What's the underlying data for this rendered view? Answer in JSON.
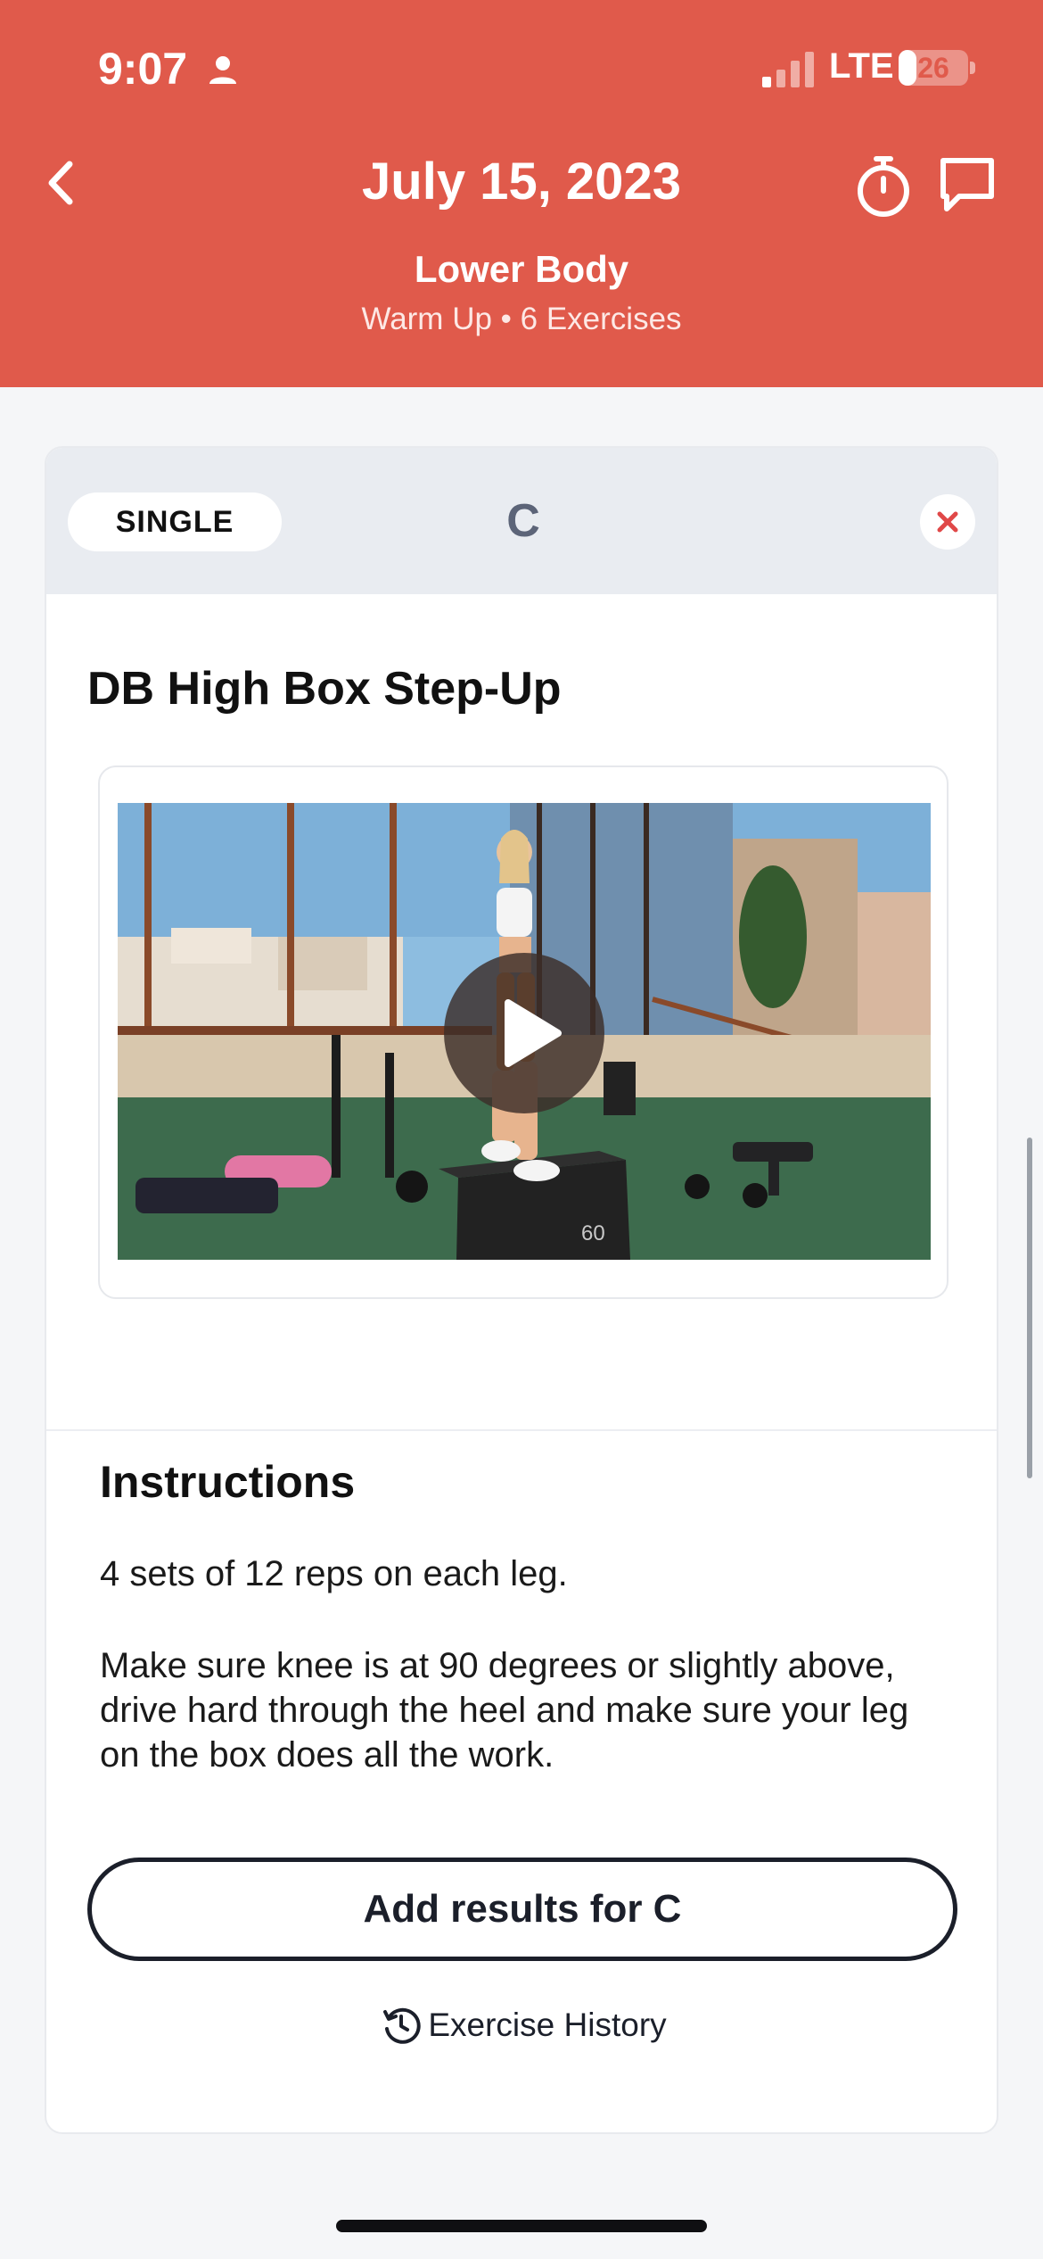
{
  "status_bar": {
    "time": "9:07",
    "network": "LTE",
    "battery_percent": "26",
    "battery_level": 0.26
  },
  "header": {
    "title": "July 15, 2023",
    "workout_name": "Lower Body",
    "workout_meta": "Warm Up • 6 Exercises",
    "background_color": "#e05a4b",
    "icons": [
      "back-icon",
      "stopwatch-icon",
      "chat-icon"
    ]
  },
  "card": {
    "type_pill": "SINGLE",
    "block_letter": "C",
    "exercise_title": "DB High Box Step-Up",
    "video": {
      "play_icon": "play-icon",
      "box_label": "60"
    },
    "instructions": {
      "heading": "Instructions",
      "line1": "4 sets of 12 reps on each leg.",
      "line2": "Make sure knee is at 90 degrees or slightly above, drive hard through the heel and make sure your leg on the box does all the work."
    },
    "add_results_label": "Add results for C",
    "history_label": "Exercise History",
    "accent_close_color": "#e04848"
  }
}
